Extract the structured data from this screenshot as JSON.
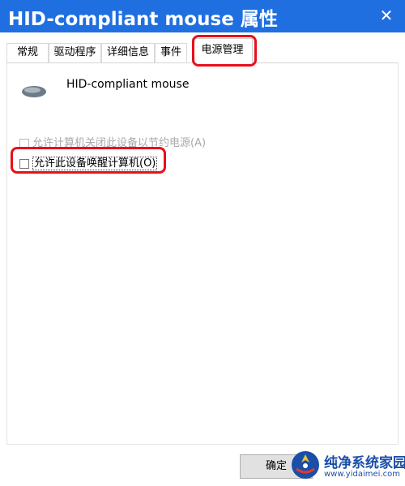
{
  "window": {
    "title": "HID-compliant mouse 属性",
    "close_glyph": "✕"
  },
  "tabs": [
    {
      "label": "常规",
      "active": false
    },
    {
      "label": "驱动程序",
      "active": false
    },
    {
      "label": "详细信息",
      "active": false
    },
    {
      "label": "事件",
      "active": false
    },
    {
      "label": "电源管理",
      "active": true
    }
  ],
  "device": {
    "name": "HID-compliant mouse",
    "icon": "mouse-icon"
  },
  "options": {
    "allow_turn_off": {
      "label": "允许计算机关闭此设备以节约电源(A)",
      "checked": false,
      "enabled": false
    },
    "allow_wake": {
      "label": "允许此设备唤醒计算机(O)",
      "checked": false,
      "enabled": true
    }
  },
  "buttons": {
    "ok": "确定"
  },
  "watermark": {
    "text": "纯净系统家园",
    "url": "www.yidaimei.com",
    "logo": "site-logo-icon"
  },
  "colors": {
    "titlebar": "#1f6fe0",
    "highlight": "#e8101a"
  }
}
